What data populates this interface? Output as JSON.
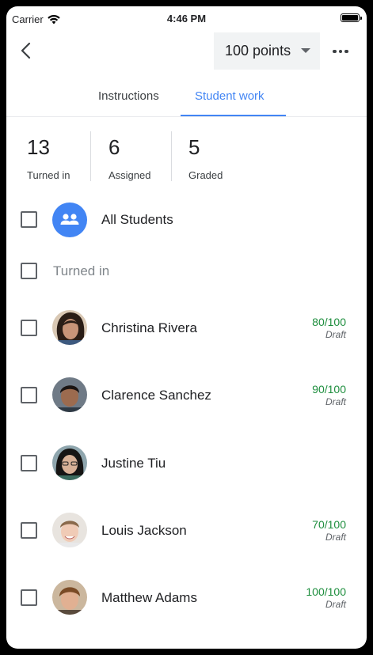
{
  "status_bar": {
    "carrier": "Carrier",
    "time": "4:46 PM"
  },
  "header": {
    "points_label": "100 points"
  },
  "tabs": [
    {
      "label": "Instructions",
      "active": false
    },
    {
      "label": "Student work",
      "active": true
    }
  ],
  "stats": [
    {
      "value": "13",
      "label": "Turned in"
    },
    {
      "value": "6",
      "label": "Assigned"
    },
    {
      "value": "5",
      "label": "Graded"
    }
  ],
  "all_students_label": "All Students",
  "section_label": "Turned in",
  "students": [
    {
      "name": "Christina Rivera",
      "score": "80/100",
      "status": "Draft"
    },
    {
      "name": "Clarence Sanchez",
      "score": "90/100",
      "status": "Draft"
    },
    {
      "name": "Justine Tiu",
      "score": "",
      "status": ""
    },
    {
      "name": "Louis Jackson",
      "score": "70/100",
      "status": "Draft"
    },
    {
      "name": "Matthew Adams",
      "score": "100/100",
      "status": "Draft"
    }
  ],
  "colors": {
    "accent": "#4285f4",
    "grade_green": "#1e8e3e"
  },
  "icons": [
    "wifi-icon",
    "battery-icon",
    "back-arrow-icon",
    "dropdown-caret-icon",
    "more-horiz-icon",
    "group-icon"
  ]
}
